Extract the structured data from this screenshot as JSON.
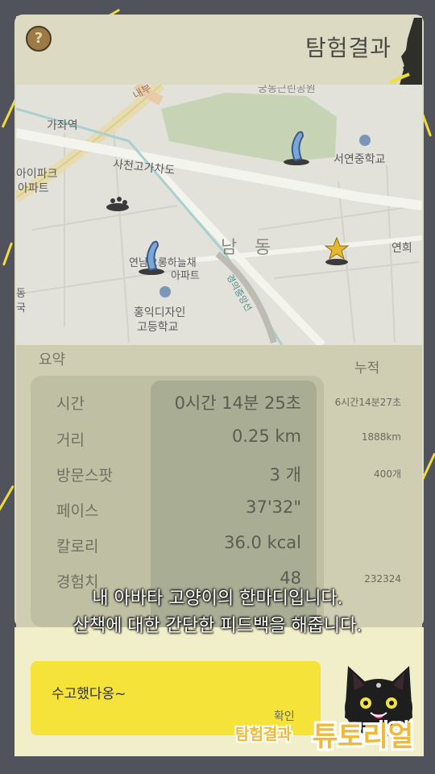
{
  "header": {
    "help_symbol": "?",
    "title": "탐험결과"
  },
  "map": {
    "labels": {
      "gajwa": "가좌역",
      "sacheon": "사천고가차도",
      "seoyeon": "서연중학교",
      "ipark1": "아이파크",
      "ipark2": "아파트",
      "nam": "남",
      "dong": "동",
      "ohrong": "연남오롱하늘채",
      "ohrong2": "아파트",
      "hongik1": "홍익디자인",
      "hongik2": "고등학교",
      "yeonhui": "연희",
      "top_road": "내부",
      "top_park": "궁동근린공원",
      "dong_left": "동",
      "dong_left2": "국",
      "rail": "경의중앙선"
    }
  },
  "summary": {
    "heading": "요약",
    "cumulative_heading": "누적",
    "rows": [
      {
        "label": "시간",
        "value": "0시간 14분 25초",
        "cumulative": "6시간14분27초"
      },
      {
        "label": "거리",
        "value": "0.25 km",
        "cumulative": "1888km"
      },
      {
        "label": "방문스팟",
        "value": "3 개",
        "cumulative": "400개"
      },
      {
        "label": "페이스",
        "value": "37'32\"",
        "cumulative": ""
      },
      {
        "label": "칼로리",
        "value": "36.0 kcal",
        "cumulative": ""
      },
      {
        "label": "경험치",
        "value": "48",
        "cumulative": "232324"
      }
    ]
  },
  "tutorial": {
    "line1": "내 아바타 고양이의 한마디입니다.",
    "line2": "산책에 대한 간단한 피드백을 해줍니다.",
    "badge_small": "탐험결과",
    "badge_big": "튜토리얼"
  },
  "avatar": {
    "message": "수고했다옹~",
    "confirm_label": "확인"
  },
  "colors": {
    "accent_yellow": "#f5e33a",
    "frame": "#dcdac2",
    "background": "#50535c",
    "badge_orange": "#f0b93a"
  }
}
